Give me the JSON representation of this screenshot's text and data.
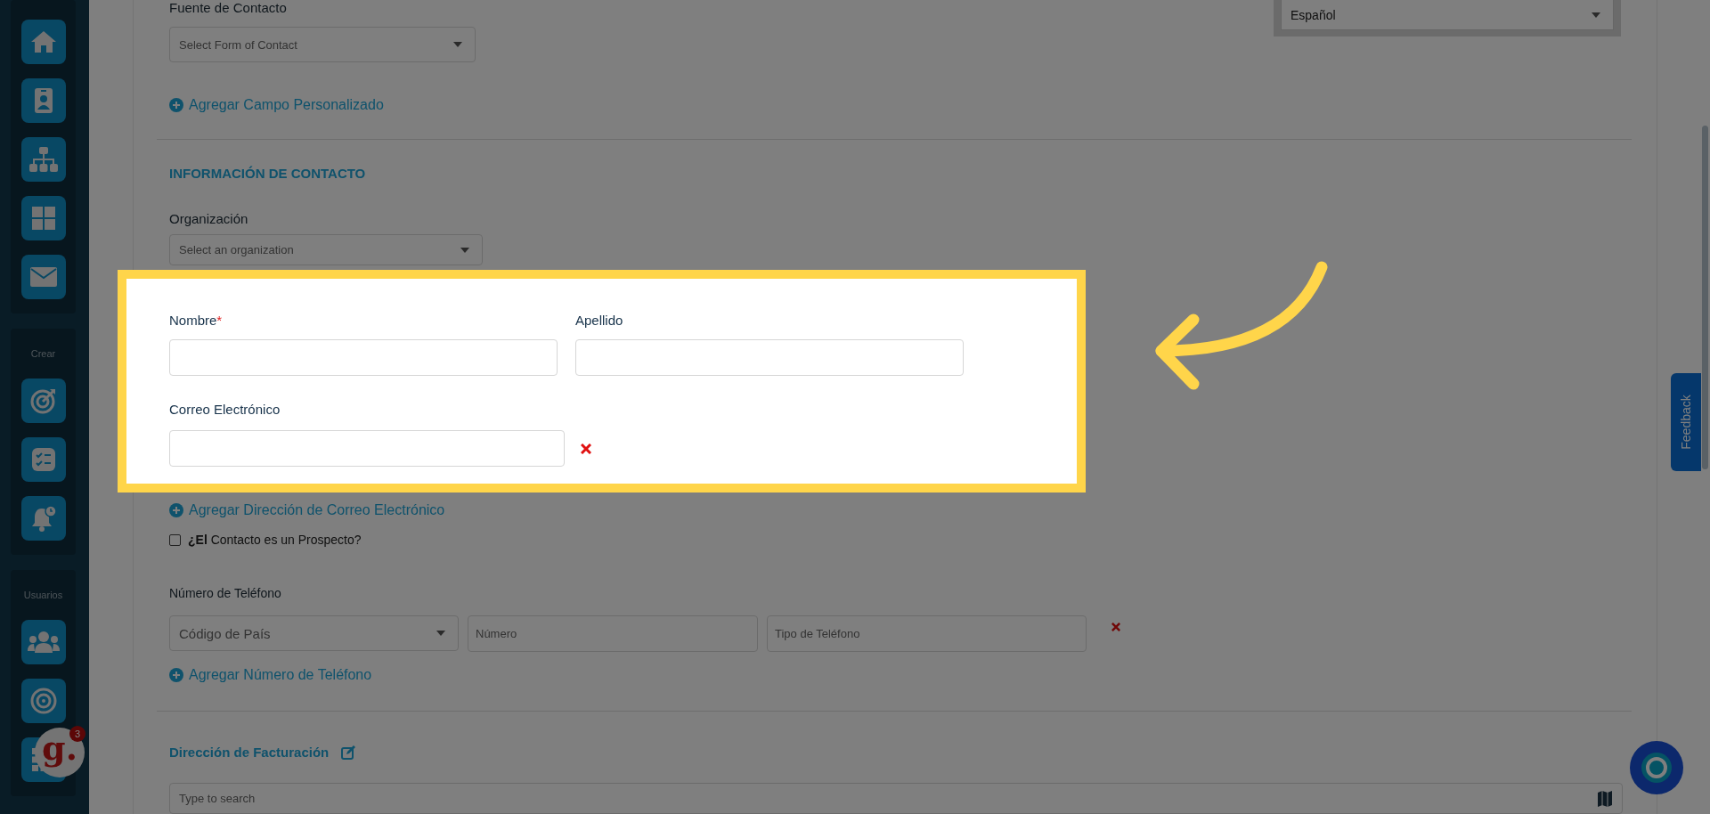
{
  "sidebar": {
    "sections": [
      {
        "heading": "Crear"
      },
      {
        "heading": "Usuarios"
      }
    ]
  },
  "language_select": {
    "value": "Español"
  },
  "form": {
    "source": {
      "label": "Fuente de Contacto",
      "placeholder": "Select Form of Contact"
    },
    "add_custom_field": "Agregar Campo Personalizado",
    "section_title": "INFORMACIÓN DE CONTACTO",
    "organization": {
      "label": "Organización",
      "placeholder": "Select an organization"
    },
    "first_name": {
      "label": "Nombre",
      "required_mark": "*"
    },
    "last_name": {
      "label": "Apellido"
    },
    "email": {
      "label": "Correo Electrónico"
    },
    "add_email": "Agregar Dirección de Correo Electrónico",
    "prospect": {
      "label": "**¿El** Contacto es un Prospecto?",
      "checked": false
    },
    "phone": {
      "label": "Número de Teléfono",
      "country_placeholder": "Código de País",
      "number_placeholder": "Número",
      "type_placeholder": "Tipo de Teléfono"
    },
    "add_phone": "Agregar Número de Teléfono",
    "billing": {
      "title": "Dirección de Facturación",
      "search_placeholder": "Type to search"
    }
  },
  "feedback_tab": "Feedback",
  "assistant_badge": {
    "logo": "g.",
    "count": "3"
  },
  "tutorial_highlight": true
}
